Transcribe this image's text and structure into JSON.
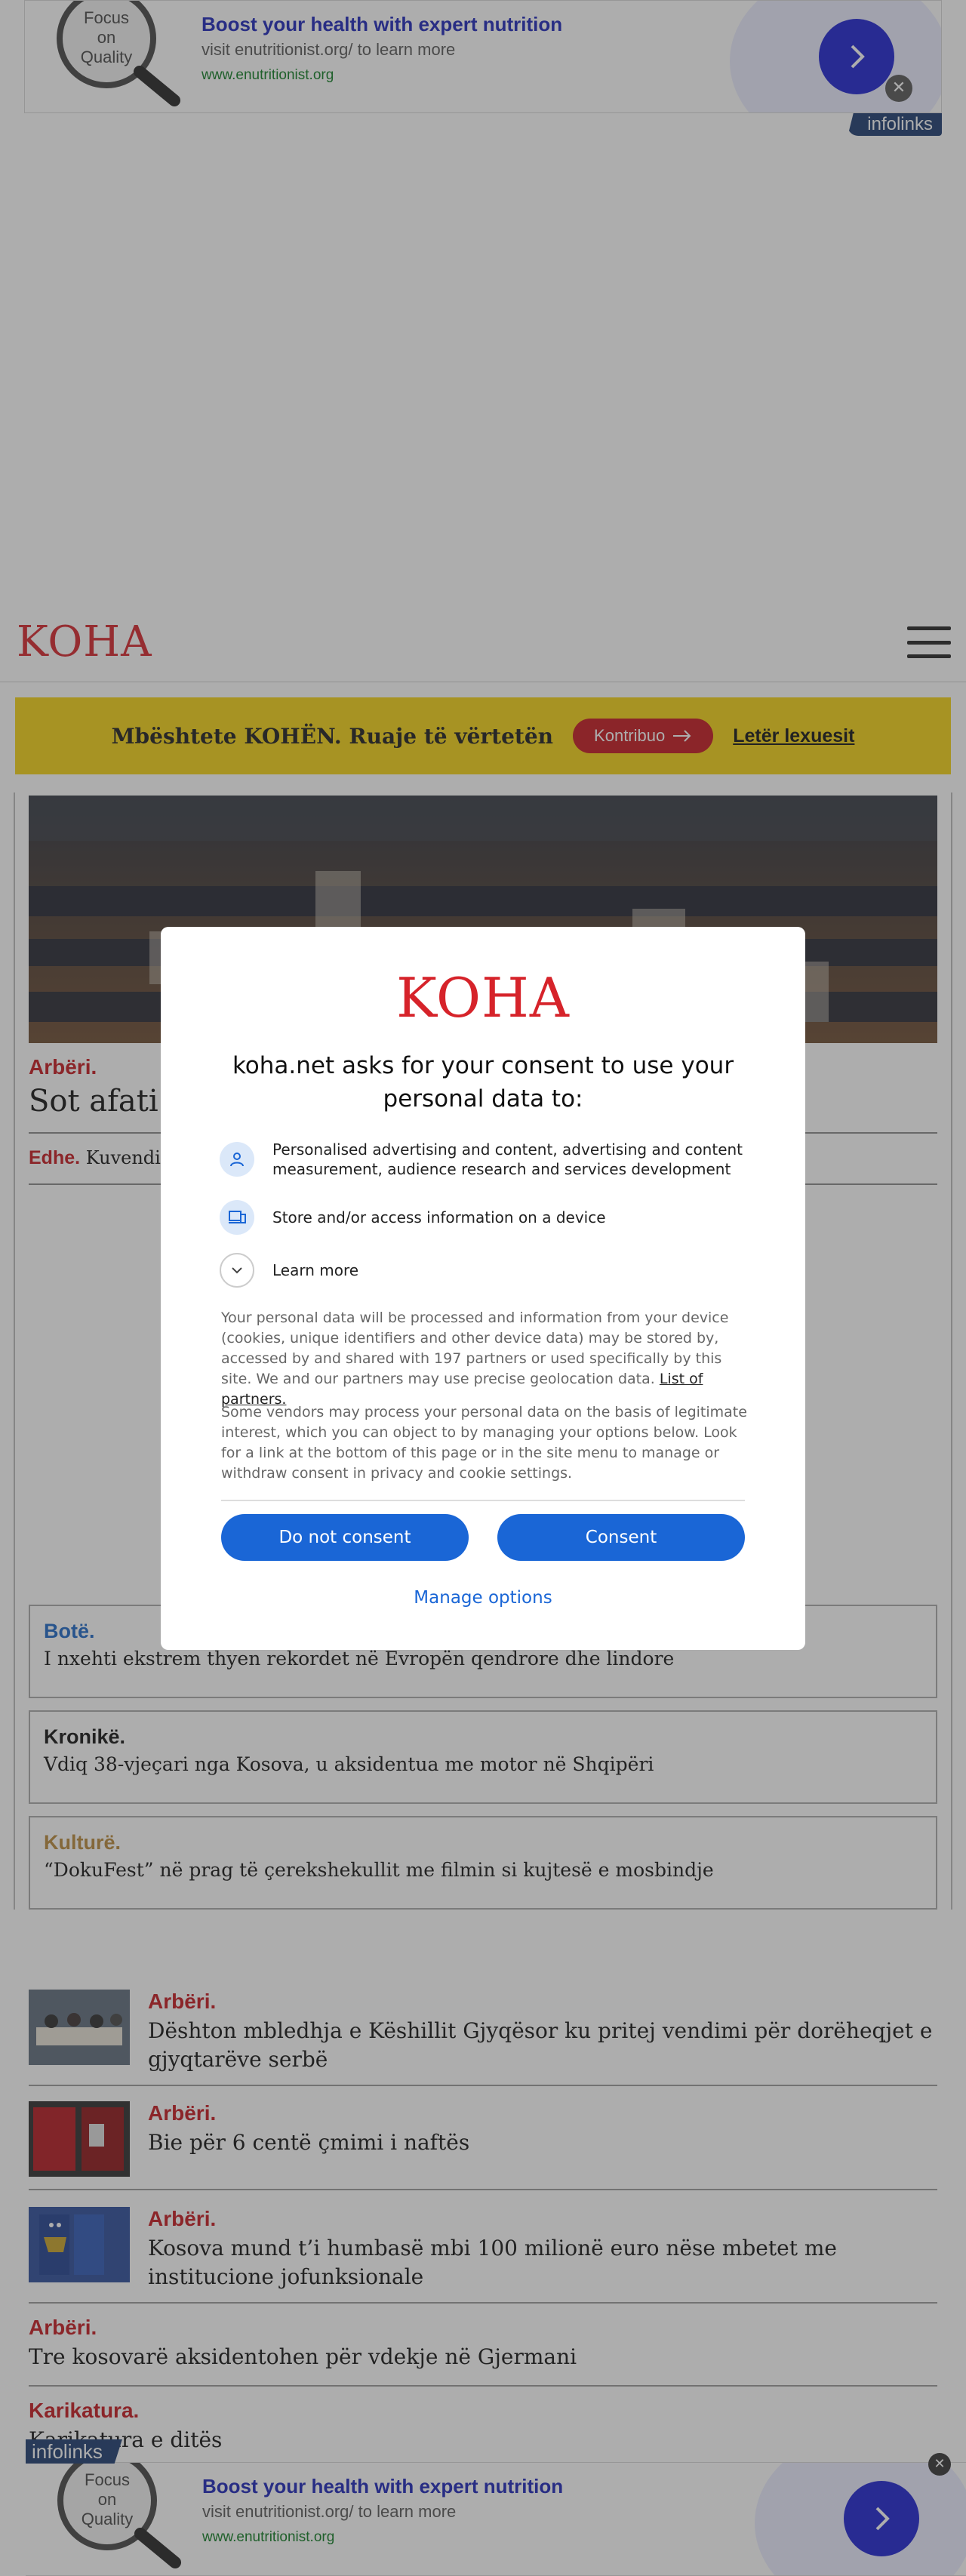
{
  "ad": {
    "logo_text": [
      "Focus",
      "on",
      "Quality"
    ],
    "title": "Boost your health with expert nutrition",
    "description": "visit enutritionist.org/ to learn more",
    "url": "www.enutritionist.org",
    "provider": "infolinks",
    "close_symbol": "✕"
  },
  "site": {
    "logo": "KOHA"
  },
  "support_bar": {
    "text": "Mbështete KOHËN. Ruaje të vërtetën",
    "button_label": "Kontribuo",
    "link_label": "Letër lexuesit"
  },
  "hero": {
    "category": "Arbëri.",
    "title_visible": "Sot afati",
    "edhe_label": "Edhe.",
    "edhe_text": "Kuvendi n"
  },
  "side_cards": [
    {
      "category": "Botë.",
      "title": "I nxehti ekstrem thyen rekordet në Evropën qendrore dhe lindore",
      "color": "#1a66c6"
    },
    {
      "category": "Kronikë.",
      "title": "Vdiq 38-vjeçari nga Kosova, u aksidentua me motor në Shqipëri",
      "color": "#111111"
    },
    {
      "category": "Kulturë.",
      "title": "“DokuFest” në prag të çerekshekullit me filmin si kujtesë e mosbindje",
      "color": "#b8893a"
    }
  ],
  "news": [
    {
      "category": "Arbëri.",
      "title": "Dështon mbledhja e Këshillit Gjyqësor ku pritej vendimi për dorëheqjet e gjyqtarëve serbë"
    },
    {
      "category": "Arbëri.",
      "title": "Bie për 6 centë çmimi i naftës"
    },
    {
      "category": "Arbëri.",
      "title": "Kosova mund t’i humbasë mbi 100 milionë euro nëse mbetet me institucione jofunksionale"
    },
    {
      "category": "Arbëri.",
      "title": "Tre kosovarë aksidentohen për vdekje në Gjermani"
    },
    {
      "category": "Karikatura.",
      "title": "Karikatura e ditës"
    }
  ],
  "consent": {
    "logo": "KOHA",
    "title": "koha.net asks for your consent to use your personal data to:",
    "purposes": [
      "Personalised advertising and content, advertising and content measurement, audience research and services development",
      "Store and/or access information on a device"
    ],
    "learn_more": "Learn more",
    "paragraph1": "Your personal data will be processed and information from your device (cookies, unique identifiers and other device data) may be stored by, accessed by and shared with 197 partners or used specifically by this site. We and our partners may use precise geolocation data.",
    "partners_link": "List of partners.",
    "paragraph2": "Some vendors may process your personal data on the basis of legitimate interest, which you can object to by managing your options below. Look for a link at the bottom of this page or in the site menu to manage or withdraw consent in privacy and cookie settings.",
    "do_not_consent": "Do not consent",
    "consent": "Consent",
    "manage_options": "Manage options"
  },
  "colors": {
    "brand_red": "#d6232a",
    "support_yellow": "#f5d312",
    "consent_blue": "#1a66d6",
    "ad_blue": "#1b1fd1"
  }
}
